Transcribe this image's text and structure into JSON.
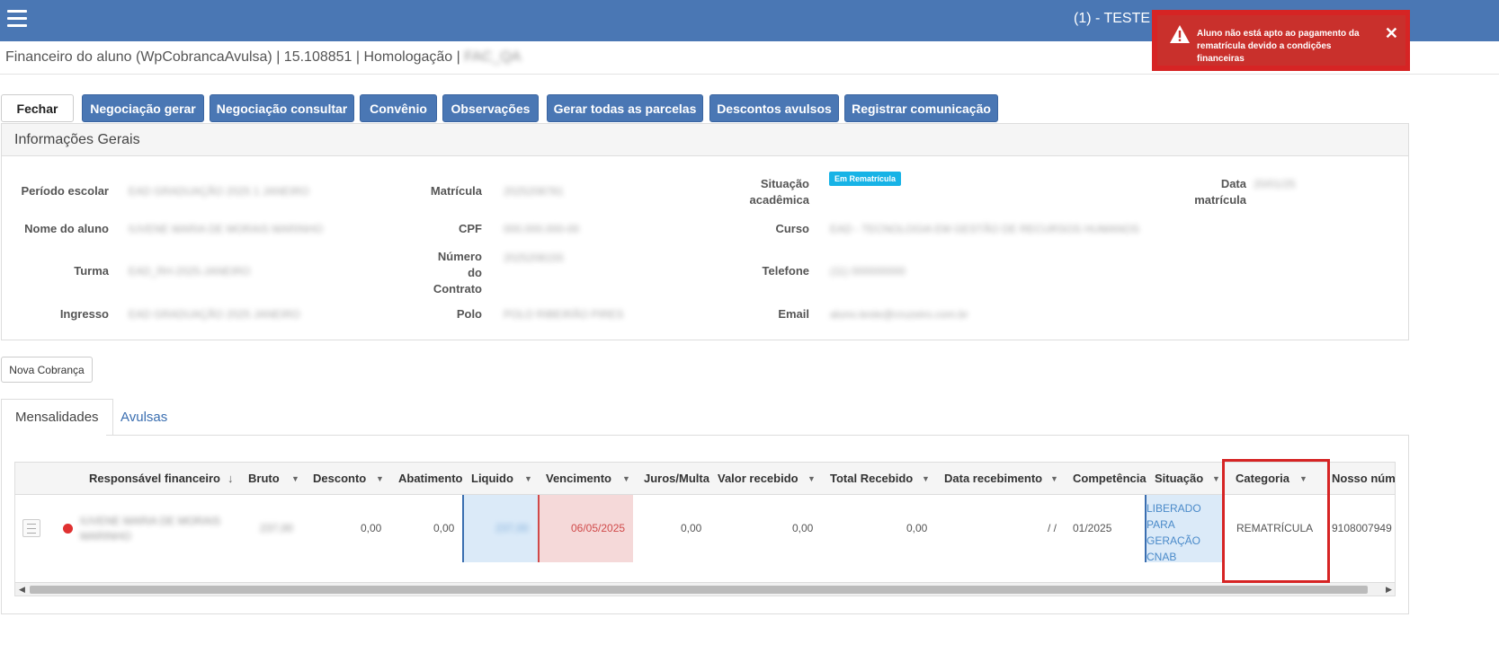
{
  "header": {
    "user_label": "(1) - TESTE ·"
  },
  "toast": {
    "message": "Aluno não está apto ao pagamento da rematrícula devido a condições financeiras",
    "close": "✕",
    "color": "#c9302c"
  },
  "breadcrumb": {
    "text": "Financeiro do aluno (WpCobrancaAvulsa) | 15.108851 | Homologação |",
    "blurred_tail": "FAC_QA"
  },
  "toolbar": {
    "fechar": "Fechar",
    "negociacao_gerar": "Negociação gerar",
    "negociacao_consultar": "Negociação consultar",
    "convenio": "Convênio",
    "observacoes": "Observações",
    "gerar_parcelas": "Gerar todas as parcelas",
    "descontos_avulsos": "Descontos avulsos",
    "registrar_comunicacao": "Registrar comunicação"
  },
  "info": {
    "title": "Informações Gerais",
    "labels": {
      "periodo": "Período escolar",
      "nome": "Nome do aluno",
      "turma": "Turma",
      "ingresso": "Ingresso",
      "matricula": "Matrícula",
      "cpf": "CPF",
      "numero_contrato": "Número do Contrato",
      "polo": "Polo",
      "situacao": "Situação acadêmica",
      "curso": "Curso",
      "telefone": "Telefone",
      "email": "Email",
      "data_matricula": "Data matrícula"
    },
    "values": {
      "periodo": "EAD GRADUAÇÃO 2025 1 JANEIRO",
      "nome": "IUVENE MARIA DE MORAIS MARINHO",
      "turma": "EAD_RH-2025-JANEIRO",
      "ingresso": "EAD GRADUAÇÃO 2025 JANEIRO",
      "matricula": "2025208781",
      "cpf": "000.000.000-00",
      "numero_contrato": "2025208155",
      "polo": "POLO RIBEIRÃO PIRES",
      "situacao_badge": "Em Rematrícula",
      "curso": "EAD - TECNOLOGIA EM GESTÃO DE RECURSOS HUMANOS",
      "telefone": "(11) 000000000",
      "email": "aluno.teste@cruzeiro.com.br",
      "data_matricula": "20/01/25"
    }
  },
  "nova_cobranca": "Nova Cobrança",
  "tabs": {
    "mensalidades": "Mensalidades",
    "avulsas": "Avulsas"
  },
  "grid": {
    "columns": {
      "responsavel": "Responsável financeiro",
      "bruto": "Bruto",
      "desconto": "Desconto",
      "abatimento": "Abatimento",
      "liquido": "Liquido",
      "vencimento": "Vencimento",
      "juros": "Juros/Multa",
      "valor_recebido": "Valor recebido",
      "total_recebido": "Total Recebido",
      "data_recebimento": "Data recebimento",
      "competencia": "Competência",
      "situacao": "Situação",
      "categoria": "Categoria",
      "nosso_numero": "Nosso núme"
    },
    "sort_icon": "↓",
    "row": {
      "responsavel": "IUVENE MARIA DE MORAIS MARINHO",
      "bruto": "237,00",
      "desconto": "0,00",
      "abatimento": "0,00",
      "liquido": "237,00",
      "vencimento": "06/05/2025",
      "juros": "0,00",
      "valor_recebido": "0,00",
      "total_recebido": "0,00",
      "data_recebimento": "/ /",
      "competencia": "01/2025",
      "situacao": "LIBERADO PARA GERAÇÃO CNAB",
      "categoria": "REMATRÍCULA",
      "nosso_numero": "9108007949"
    }
  }
}
